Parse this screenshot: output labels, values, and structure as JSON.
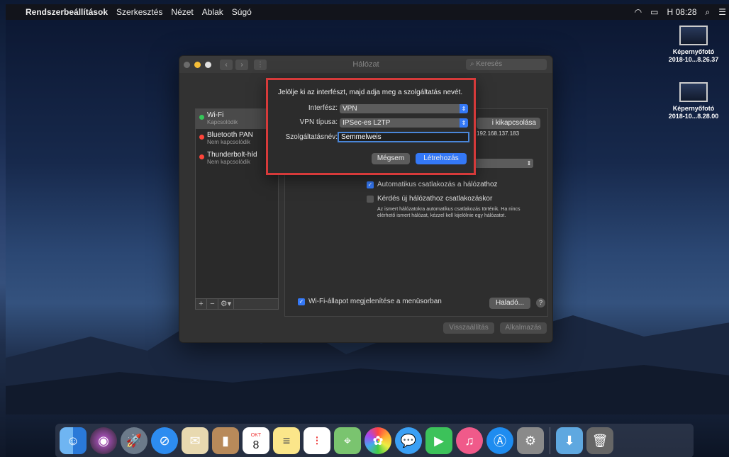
{
  "menubar": {
    "app": "Rendszerbeállítások",
    "items": [
      "Szerkesztés",
      "Nézet",
      "Ablak",
      "Súgó"
    ],
    "clock": "H 08:28"
  },
  "desktop_icons": [
    {
      "name1": "Képernyőfotó",
      "name2": "2018-10...8.26.37"
    },
    {
      "name1": "Képernyőfotó",
      "name2": "2018-10...8.28.00"
    }
  ],
  "window": {
    "title": "Hálózat",
    "search_placeholder": "Keresés",
    "services": [
      {
        "name": "Wi-Fi",
        "status": "Kapcsolódik",
        "color": "#35c759"
      },
      {
        "name": "Bluetooth PAN",
        "status": "Nem kapcsolódik",
        "color": "#ff453a"
      },
      {
        "name": "Thunderbolt-híd",
        "status": "Nem kapcsolódik",
        "color": "#ff453a"
      }
    ],
    "wifi_off_button": "i kikapcsolása",
    "ip_text": "192.168.137.183",
    "auto_connect": "Automatikus csatlakozás a hálózathoz",
    "ask_new": "Kérdés új hálózathoz csatlakozáskor",
    "ask_new_desc": "Az ismert hálózatokra automatikus csatlakozás történik. Ha nincs elérhető ismert hálózat, kézzel kell kijelölnie egy hálózatot.",
    "show_status": "Wi-Fi-állapot megjelenítése a menüsorban",
    "advanced": "Haladó...",
    "help": "?",
    "revert": "Visszaállítás",
    "apply": "Alkalmazás"
  },
  "sheet": {
    "prompt": "Jelölje ki az interfészt, majd adja meg a szolgáltatás nevét.",
    "interface_label": "Interfész:",
    "interface_value": "VPN",
    "vpn_type_label": "VPN típusa:",
    "vpn_type_value": "IPSec-es L2TP",
    "service_name_label": "Szolgáltatásnév:",
    "service_name_value": "Semmelweis",
    "cancel": "Mégsem",
    "create": "Létrehozás"
  },
  "calendar": {
    "month": "OKT",
    "day": "8"
  },
  "colors": {
    "accent": "#3478f6",
    "highlight": "#d63a3a"
  }
}
